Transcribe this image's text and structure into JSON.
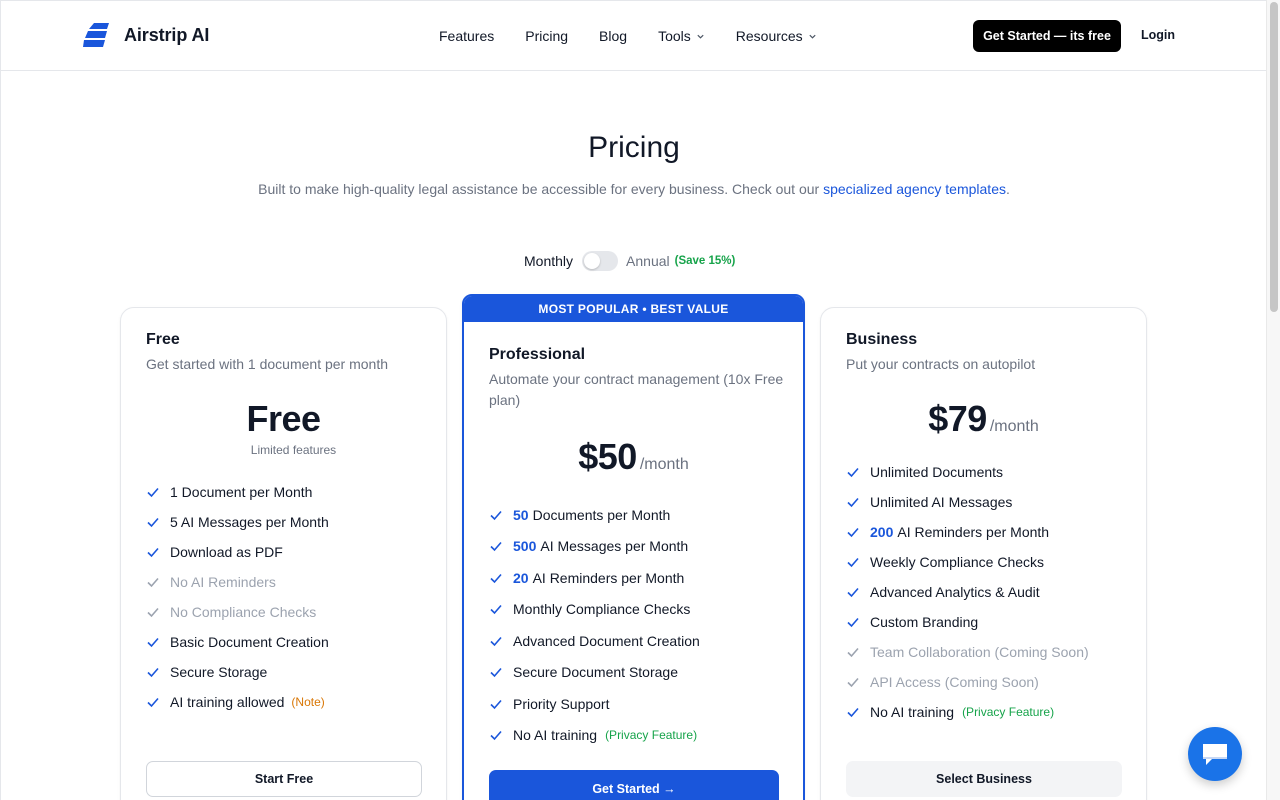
{
  "header": {
    "brand": "Airstrip AI",
    "nav": [
      {
        "label": "Features"
      },
      {
        "label": "Pricing"
      },
      {
        "label": "Blog"
      },
      {
        "label": "Tools"
      },
      {
        "label": "Resources"
      }
    ],
    "cta_label": "Get Started — its free",
    "login_label": "Login"
  },
  "hero": {
    "title": "Pricing",
    "subtitle": "Built to make high-quality legal assistance be accessible for every business. Check out our",
    "subtitle_link": "specialized agency templates",
    "subtitle_end": "."
  },
  "billing": {
    "monthly": "Monthly",
    "annual": "Annual",
    "save": "(Save 15%)",
    "annual_selected": false
  },
  "plans": {
    "free": {
      "name": "Free",
      "desc": "Get started with 1 document per month",
      "price": "Free",
      "price_note": "Limited features",
      "features": [
        {
          "text": "1 Document per Month"
        },
        {
          "text": "5 AI Messages per Month"
        },
        {
          "text": "Download as PDF"
        },
        {
          "text": "No AI Reminders"
        },
        {
          "text": "No Compliance Checks"
        },
        {
          "text": "Basic Document Creation"
        },
        {
          "text": "Secure Storage"
        },
        {
          "text": "AI training allowed",
          "note": "(Note)"
        }
      ],
      "button": "Start Free"
    },
    "pro": {
      "badge": "MOST POPULAR • BEST VALUE",
      "name": "Professional",
      "desc": "Automate your contract management (10x Free plan)",
      "price": "$50",
      "per": "/month",
      "features": [
        {
          "hl": "50",
          "text": "Documents per Month"
        },
        {
          "hl": "500",
          "text": "AI Messages per Month"
        },
        {
          "hl": "20",
          "text": "AI Reminders per Month"
        },
        {
          "text": "Monthly Compliance Checks"
        },
        {
          "text": "Advanced Document Creation"
        },
        {
          "text": "Secure Document Storage"
        },
        {
          "text": "Priority Support"
        },
        {
          "text": "No AI training",
          "note": "(Privacy Feature)"
        }
      ],
      "button": "Get Started →"
    },
    "business": {
      "name": "Business",
      "desc": "Put your contracts on autopilot",
      "price": "$79",
      "per": "/month",
      "features": [
        {
          "text": "Unlimited Documents"
        },
        {
          "text": "Unlimited AI Messages"
        },
        {
          "hl": "200",
          "text": "AI Reminders per Month"
        },
        {
          "text": "Weekly Compliance Checks"
        },
        {
          "text": "Advanced Analytics & Audit"
        },
        {
          "text": "Custom Branding"
        },
        {
          "text": "Team Collaboration (Coming Soon)"
        },
        {
          "text": "API Access (Coming Soon)"
        },
        {
          "text": "No AI training",
          "note": "(Privacy Feature)"
        }
      ],
      "button": "Select Business"
    }
  },
  "colors": {
    "accent": "#1a56db",
    "green": "#16a34a",
    "orange": "#d97706",
    "muted": "#9ca3af"
  },
  "icons": {
    "logo": "airstrip-logo-icon",
    "chevron": "chevron-down-icon",
    "check": "check-icon",
    "chat": "chat-bubble-icon"
  }
}
